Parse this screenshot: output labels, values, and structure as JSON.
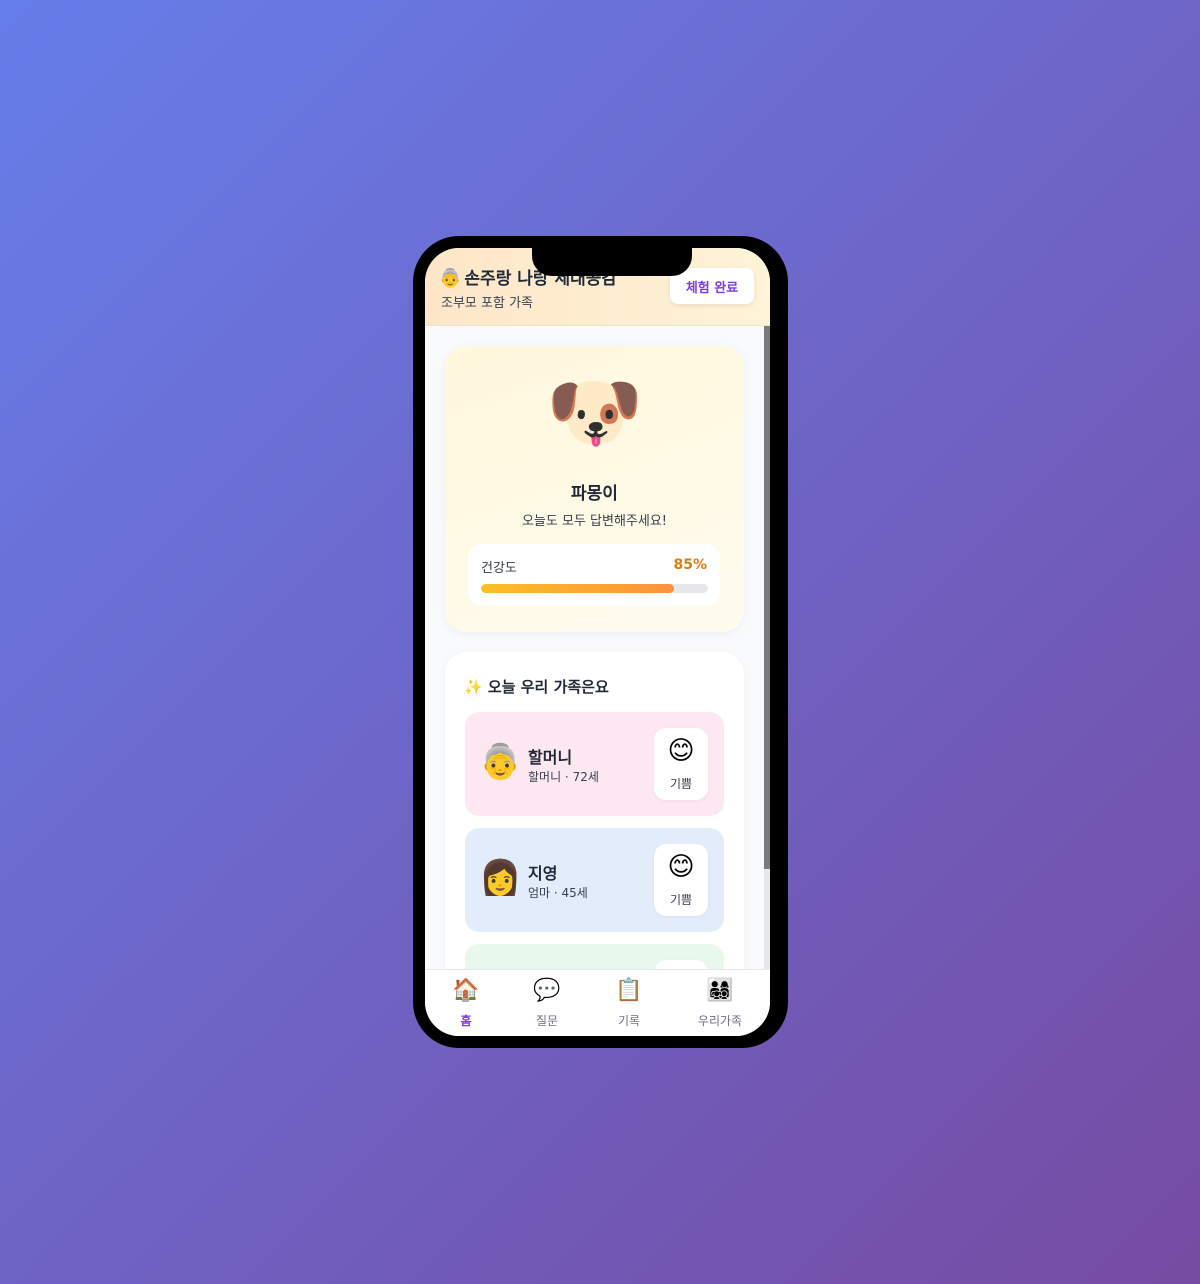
{
  "header": {
    "title_emoji": "👵",
    "title": "손주랑 나랑 세대공감",
    "subtitle": "조부모 포함 가족",
    "complete_button": "체험 완료"
  },
  "pet": {
    "emoji": "🐶",
    "name": "파몽이",
    "message": "오늘도 모두 답변해주세요!",
    "health_label": "건강도",
    "health_value": "85%",
    "health_percent": 85
  },
  "family": {
    "title_emoji": "✨",
    "title": "오늘 우리 가족은요",
    "members": [
      {
        "avatar": "👵",
        "name": "할머니",
        "info": "할머니 · 72세",
        "mood_icon": "😊",
        "mood": "기쁨",
        "bg": "#fde8f1"
      },
      {
        "avatar": "👩",
        "name": "지영",
        "info": "엄마 · 45세",
        "mood_icon": "😊",
        "mood": "기쁨",
        "bg": "#e3ecfb"
      }
    ],
    "partial_member_bg": "#e8f8ec"
  },
  "tabs": [
    {
      "icon": "🏠",
      "label": "홈"
    },
    {
      "icon": "💬",
      "label": "질문"
    },
    {
      "icon": "📋",
      "label": "기록"
    },
    {
      "icon": "👨‍👩‍👧‍👦",
      "label": "우리가족"
    }
  ],
  "accent_color": "#7c3aed"
}
